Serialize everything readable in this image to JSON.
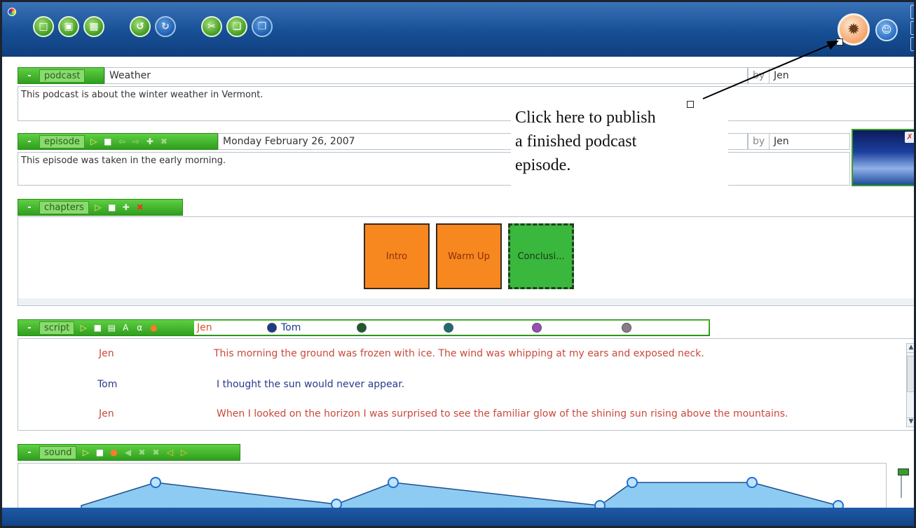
{
  "toolbar": {
    "buttons": [
      {
        "icon": "new-document-icon"
      },
      {
        "icon": "open-icon"
      },
      {
        "icon": "save-icon"
      },
      {
        "icon": "undo-icon"
      },
      {
        "icon": "redo-icon"
      },
      {
        "icon": "cut-icon"
      },
      {
        "icon": "copy-icon"
      },
      {
        "icon": "paste-icon"
      }
    ],
    "publish_icon": "satellite-dish-icon",
    "share_icon": "people-icon",
    "colors": {
      "bar": "#174f95",
      "accent_green": "#3a9e22",
      "publish": "#f3a46b"
    }
  },
  "podcast": {
    "label": "podcast",
    "title": "Weather",
    "by_label": "by",
    "author": "Jen",
    "description": "This podcast is about the winter weather in Vermont."
  },
  "episode": {
    "label": "episode",
    "date": "Monday February 26, 2007",
    "by_label": "by",
    "author": "Jen",
    "description": "This episode was taken in the early morning."
  },
  "chapters": {
    "label": "chapters",
    "items": [
      {
        "title": "Intro",
        "state": "normal"
      },
      {
        "title": "Warm Up",
        "state": "normal"
      },
      {
        "title": "Conclusi...",
        "state": "selected"
      }
    ]
  },
  "script": {
    "label": "script",
    "speakers": [
      {
        "name": "Jen",
        "color": "#d9532c"
      },
      {
        "name": "Tom",
        "color": "#1d3a8a"
      },
      {
        "name": "",
        "color": "#1f5a2a"
      },
      {
        "name": "",
        "color": "#1f6a72"
      },
      {
        "name": "",
        "color": "#9a4db5"
      },
      {
        "name": "",
        "color": "#8a7a8a"
      }
    ],
    "lines": [
      {
        "speaker": "Jen",
        "text": "This morning the ground was frozen with ice.  The wind was whipping at my ears and exposed neck.",
        "color": "#c94a3a"
      },
      {
        "speaker": "Tom",
        "text": "I thought the sun would never appear.",
        "color": "#2a3a8a"
      },
      {
        "speaker": "Jen",
        "text": "When I looked on the horizon I was surprised to see the familiar glow of the shining sun rising above the mountains.",
        "color": "#c94a3a"
      }
    ]
  },
  "sound": {
    "label": "sound",
    "envelope_color": "#6fb8ee"
  },
  "annotation": {
    "line1": "Click here to publish",
    "line2": "a finished podcast",
    "line3": "episode."
  }
}
